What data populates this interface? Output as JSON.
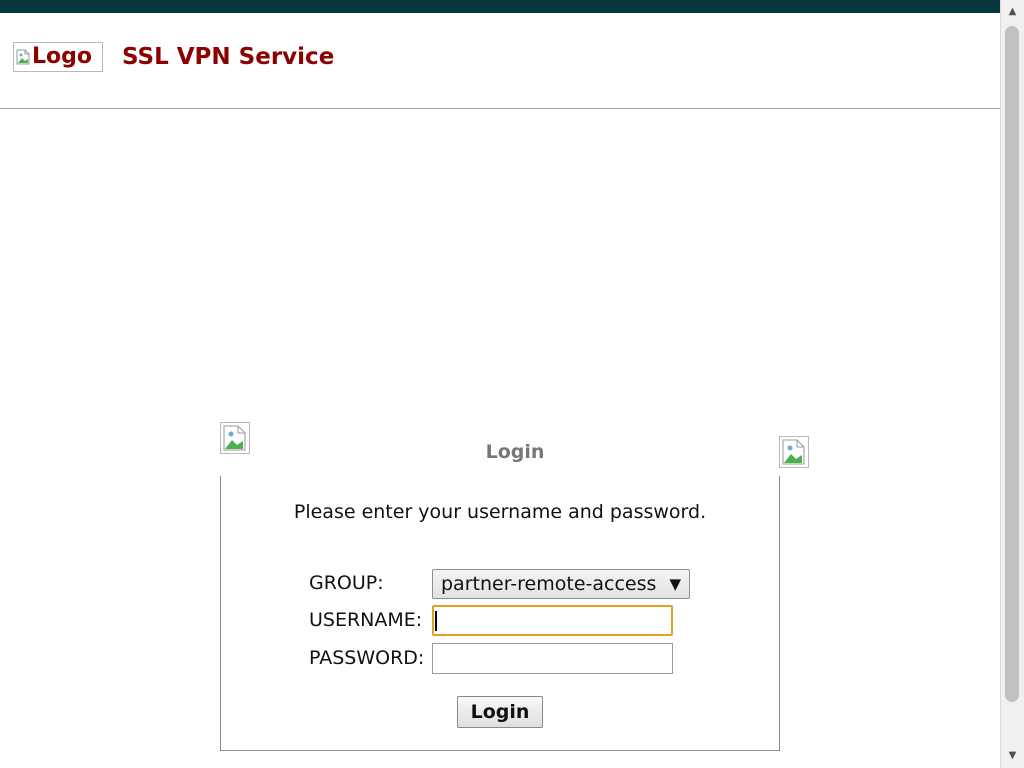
{
  "header": {
    "logo_alt": "Logo",
    "title": "SSL VPN Service"
  },
  "login": {
    "title": "Login",
    "instructions": "Please enter your username and password.",
    "group_label": "GROUP:",
    "group_selected": "partner-remote-access",
    "username_label": "USERNAME:",
    "username_value": "",
    "password_label": "PASSWORD:",
    "password_value": "",
    "submit_label": "Login"
  },
  "scrollbar": {
    "up_arrow": "▲",
    "down_arrow": "▼"
  },
  "select_arrow": "▼",
  "colors": {
    "top_band": "#06363a",
    "brand_red": "#8b0000",
    "focus_outline": "#e0a02d"
  }
}
